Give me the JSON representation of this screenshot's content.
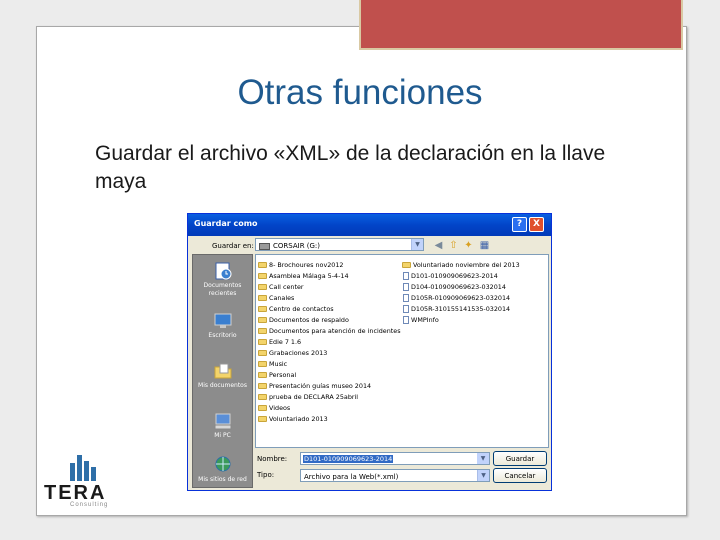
{
  "slide": {
    "title": "Otras funciones",
    "body": "Guardar el archivo «XML» de la declaración en la llave maya",
    "accent_color": "#c0504d",
    "title_color": "#1f5a8f"
  },
  "dialog": {
    "title": "Guardar como",
    "help_label": "?",
    "close_label": "X",
    "save_in_label": "Guardar en:",
    "save_in_value": "CORSAIR (G:)",
    "toolbar_icons": [
      "back-icon",
      "up-folder-icon",
      "new-folder-icon",
      "views-icon"
    ],
    "places": [
      {
        "label": "Documentos recientes",
        "icon": "recent-documents-icon"
      },
      {
        "label": "Escritorio",
        "icon": "desktop-icon"
      },
      {
        "label": "Mis documentos",
        "icon": "my-documents-icon"
      },
      {
        "label": "Mi PC",
        "icon": "my-computer-icon"
      },
      {
        "label": "Mis sitios de red",
        "icon": "network-places-icon"
      }
    ],
    "files_col1": [
      "8- Brochoures nov2012",
      "Asamblea Málaga 5-4-14",
      "Call center",
      "Canales",
      "Centro de contactos",
      "Documentos de respaldo",
      "Documentos para atención de incidentes",
      "Edie 7 1.6",
      "Grabaciones 2013",
      "Music",
      "Personal",
      "Presentación guías museo 2014",
      "prueba de DECLARA 25abril",
      "Videos",
      "Voluntariado 2013"
    ],
    "files_col2": [
      {
        "name": "Voluntariado noviembre del 2013",
        "type": "folder"
      },
      {
        "name": "D101-010909069623-2014",
        "type": "file"
      },
      {
        "name": "D104-010909069623-032014",
        "type": "file"
      },
      {
        "name": "D105R-010909069623-032014",
        "type": "file"
      },
      {
        "name": "D105R-310155141535-032014",
        "type": "file"
      },
      {
        "name": "WMPInfo",
        "type": "file"
      }
    ],
    "name_label": "Nombre:",
    "name_value": "D101-010909069623-2014",
    "type_label": "Tipo:",
    "type_value": "Archivo para la Web(*.xml)",
    "save_button": "Guardar",
    "cancel_button": "Cancelar"
  },
  "logo": {
    "name": "TERA",
    "sub": "Consulting",
    "color": "#2e6fa8"
  }
}
